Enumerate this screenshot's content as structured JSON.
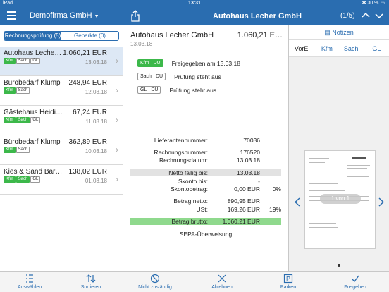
{
  "status_bar": {
    "device": "iPad",
    "wifi": "wifi",
    "time": "13:31",
    "bluetooth": "✱",
    "battery": "30 %"
  },
  "left_nav": {
    "company": "Demofirma GmbH"
  },
  "right_nav": {
    "title": "Autohaus Lecher GmbH",
    "position": "(1/5)"
  },
  "segments": [
    "Rechnungsprüfung (5)",
    "Geparkte (0)"
  ],
  "invoices": [
    {
      "name": "Autohaus Lecher…",
      "amount": "1.060,21 EUR",
      "date": "13.03.18",
      "tags": [
        "Kfm",
        "Sach",
        "GL"
      ],
      "tag_green": [
        true,
        false,
        false
      ]
    },
    {
      "name": "Bürobedarf Klump",
      "amount": "248,94 EUR",
      "date": "12.03.18",
      "tags": [
        "Kfm",
        "Sach"
      ],
      "tag_green": [
        true,
        false
      ]
    },
    {
      "name": "Gästehaus Heidi's Be…",
      "amount": "67,24 EUR",
      "date": "11.03.18",
      "tags": [
        "Kfm",
        "Sach",
        "GL"
      ],
      "tag_green": [
        true,
        true,
        false
      ]
    },
    {
      "name": "Bürobedarf Klump",
      "amount": "362,89 EUR",
      "date": "10.03.18",
      "tags": [
        "Kfm",
        "Sach"
      ],
      "tag_green": [
        true,
        false
      ]
    },
    {
      "name": "Kies & Sand Bartma…",
      "amount": "138,02 EUR",
      "date": "01.03.18",
      "tags": [
        "Kfm",
        "Sach",
        "GL"
      ],
      "tag_green": [
        true,
        true,
        false
      ]
    }
  ],
  "detail": {
    "vendor": "Autohaus Lecher GmbH",
    "total": "1.060,21 E…",
    "date": "13.03.18",
    "approvals": [
      {
        "role": "Kfm",
        "code": "DU",
        "text": "Freigegeben am 13.03.18",
        "green": true
      },
      {
        "role": "Sach",
        "code": "DU",
        "text": "Prüfung steht aus",
        "green": false
      },
      {
        "role": "GL",
        "code": "DU",
        "text": "Prüfung steht aus",
        "green": false
      }
    ],
    "fields": [
      {
        "label": "Lieferantennummer:",
        "value": "70036",
        "pct": "",
        "style": ""
      },
      {
        "label": "Rechnungsnummer:",
        "value": "176520",
        "pct": "",
        "style": ""
      },
      {
        "label": "Rechnungsdatum:",
        "value": "13.03.18",
        "pct": "",
        "style": ""
      },
      {
        "label": "Netto fällig bis:",
        "value": "13.03.18",
        "pct": "",
        "style": "grey"
      },
      {
        "label": "Skonto bis:",
        "value": "-",
        "pct": "",
        "style": ""
      },
      {
        "label": "Skontobetrag:",
        "value": "0,00 EUR",
        "pct": "0%",
        "style": ""
      },
      {
        "label": "Betrag netto:",
        "value": "890,95 EUR",
        "pct": "",
        "style": ""
      },
      {
        "label": "USt:",
        "value": "169,26 EUR",
        "pct": "19%",
        "style": ""
      },
      {
        "label": "Betrag brutto:",
        "value": "1.060,21 EUR",
        "pct": "",
        "style": "green"
      }
    ],
    "payment": "SEPA-Überweisung"
  },
  "notes_label": "Notizen",
  "tabs": [
    "VorE",
    "Kfm",
    "Sachl",
    "GL"
  ],
  "document": {
    "page_indicator": "1 von 1"
  },
  "toolbar": {
    "select": "Auswählen",
    "sort": "Sortieren",
    "not_responsible": "Nicht zuständig",
    "reject": "Ablehnen",
    "park": "Parken",
    "approve": "Freigeben"
  },
  "colors": {
    "brand": "#2a6db0",
    "approved": "#3cb84a",
    "highlight_green": "#8fd98d"
  }
}
